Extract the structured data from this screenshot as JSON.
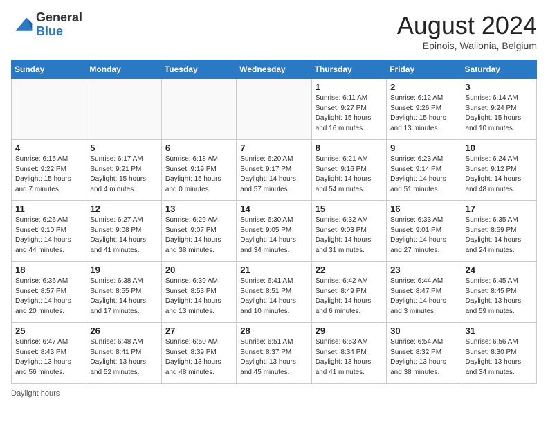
{
  "header": {
    "logo_general": "General",
    "logo_blue": "Blue",
    "month_year": "August 2024",
    "location": "Epinois, Wallonia, Belgium"
  },
  "days_of_week": [
    "Sunday",
    "Monday",
    "Tuesday",
    "Wednesday",
    "Thursday",
    "Friday",
    "Saturday"
  ],
  "weeks": [
    [
      {
        "num": "",
        "info": ""
      },
      {
        "num": "",
        "info": ""
      },
      {
        "num": "",
        "info": ""
      },
      {
        "num": "",
        "info": ""
      },
      {
        "num": "1",
        "info": "Sunrise: 6:11 AM\nSunset: 9:27 PM\nDaylight: 15 hours and 16 minutes."
      },
      {
        "num": "2",
        "info": "Sunrise: 6:12 AM\nSunset: 9:26 PM\nDaylight: 15 hours and 13 minutes."
      },
      {
        "num": "3",
        "info": "Sunrise: 6:14 AM\nSunset: 9:24 PM\nDaylight: 15 hours and 10 minutes."
      }
    ],
    [
      {
        "num": "4",
        "info": "Sunrise: 6:15 AM\nSunset: 9:22 PM\nDaylight: 15 hours and 7 minutes."
      },
      {
        "num": "5",
        "info": "Sunrise: 6:17 AM\nSunset: 9:21 PM\nDaylight: 15 hours and 4 minutes."
      },
      {
        "num": "6",
        "info": "Sunrise: 6:18 AM\nSunset: 9:19 PM\nDaylight: 15 hours and 0 minutes."
      },
      {
        "num": "7",
        "info": "Sunrise: 6:20 AM\nSunset: 9:17 PM\nDaylight: 14 hours and 57 minutes."
      },
      {
        "num": "8",
        "info": "Sunrise: 6:21 AM\nSunset: 9:16 PM\nDaylight: 14 hours and 54 minutes."
      },
      {
        "num": "9",
        "info": "Sunrise: 6:23 AM\nSunset: 9:14 PM\nDaylight: 14 hours and 51 minutes."
      },
      {
        "num": "10",
        "info": "Sunrise: 6:24 AM\nSunset: 9:12 PM\nDaylight: 14 hours and 48 minutes."
      }
    ],
    [
      {
        "num": "11",
        "info": "Sunrise: 6:26 AM\nSunset: 9:10 PM\nDaylight: 14 hours and 44 minutes."
      },
      {
        "num": "12",
        "info": "Sunrise: 6:27 AM\nSunset: 9:08 PM\nDaylight: 14 hours and 41 minutes."
      },
      {
        "num": "13",
        "info": "Sunrise: 6:29 AM\nSunset: 9:07 PM\nDaylight: 14 hours and 38 minutes."
      },
      {
        "num": "14",
        "info": "Sunrise: 6:30 AM\nSunset: 9:05 PM\nDaylight: 14 hours and 34 minutes."
      },
      {
        "num": "15",
        "info": "Sunrise: 6:32 AM\nSunset: 9:03 PM\nDaylight: 14 hours and 31 minutes."
      },
      {
        "num": "16",
        "info": "Sunrise: 6:33 AM\nSunset: 9:01 PM\nDaylight: 14 hours and 27 minutes."
      },
      {
        "num": "17",
        "info": "Sunrise: 6:35 AM\nSunset: 8:59 PM\nDaylight: 14 hours and 24 minutes."
      }
    ],
    [
      {
        "num": "18",
        "info": "Sunrise: 6:36 AM\nSunset: 8:57 PM\nDaylight: 14 hours and 20 minutes."
      },
      {
        "num": "19",
        "info": "Sunrise: 6:38 AM\nSunset: 8:55 PM\nDaylight: 14 hours and 17 minutes."
      },
      {
        "num": "20",
        "info": "Sunrise: 6:39 AM\nSunset: 8:53 PM\nDaylight: 14 hours and 13 minutes."
      },
      {
        "num": "21",
        "info": "Sunrise: 6:41 AM\nSunset: 8:51 PM\nDaylight: 14 hours and 10 minutes."
      },
      {
        "num": "22",
        "info": "Sunrise: 6:42 AM\nSunset: 8:49 PM\nDaylight: 14 hours and 6 minutes."
      },
      {
        "num": "23",
        "info": "Sunrise: 6:44 AM\nSunset: 8:47 PM\nDaylight: 14 hours and 3 minutes."
      },
      {
        "num": "24",
        "info": "Sunrise: 6:45 AM\nSunset: 8:45 PM\nDaylight: 13 hours and 59 minutes."
      }
    ],
    [
      {
        "num": "25",
        "info": "Sunrise: 6:47 AM\nSunset: 8:43 PM\nDaylight: 13 hours and 56 minutes."
      },
      {
        "num": "26",
        "info": "Sunrise: 6:48 AM\nSunset: 8:41 PM\nDaylight: 13 hours and 52 minutes."
      },
      {
        "num": "27",
        "info": "Sunrise: 6:50 AM\nSunset: 8:39 PM\nDaylight: 13 hours and 48 minutes."
      },
      {
        "num": "28",
        "info": "Sunrise: 6:51 AM\nSunset: 8:37 PM\nDaylight: 13 hours and 45 minutes."
      },
      {
        "num": "29",
        "info": "Sunrise: 6:53 AM\nSunset: 8:34 PM\nDaylight: 13 hours and 41 minutes."
      },
      {
        "num": "30",
        "info": "Sunrise: 6:54 AM\nSunset: 8:32 PM\nDaylight: 13 hours and 38 minutes."
      },
      {
        "num": "31",
        "info": "Sunrise: 6:56 AM\nSunset: 8:30 PM\nDaylight: 13 hours and 34 minutes."
      }
    ]
  ],
  "footer": {
    "daylight_hours_label": "Daylight hours"
  }
}
